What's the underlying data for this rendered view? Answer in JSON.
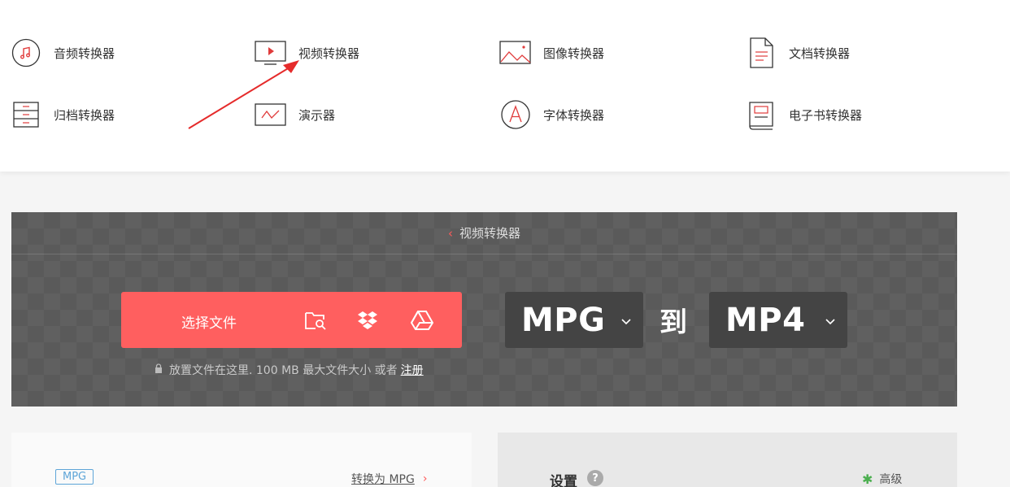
{
  "menu": {
    "items": [
      {
        "label": "音频转换器",
        "icon": "music-note-icon"
      },
      {
        "label": "视频转换器",
        "icon": "video-play-icon"
      },
      {
        "label": "图像转换器",
        "icon": "image-icon"
      },
      {
        "label": "文档转换器",
        "icon": "document-icon"
      },
      {
        "label": "归档转换器",
        "icon": "archive-icon"
      },
      {
        "label": "演示器",
        "icon": "presentation-icon"
      },
      {
        "label": "字体转换器",
        "icon": "font-icon"
      },
      {
        "label": "电子书转换器",
        "icon": "ebook-icon"
      }
    ]
  },
  "colors": {
    "accent": "#ff5f5f",
    "panel": "#5a5a5a",
    "select_bg": "#444444",
    "link_blue": "#5ea5d8",
    "gear_green": "#4caf50"
  },
  "converter": {
    "breadcrumb": "视频转换器",
    "choose_file": "选择文件",
    "drop_text": "放置文件在这里. 100 MB 最大文件大小 或者",
    "register": "注册",
    "from_format": "MPG",
    "to_word": "到",
    "to_format": "MP4"
  },
  "lower": {
    "badge": "MPG",
    "convert_to": "转换为 MPG",
    "settings": "设置",
    "help": "?",
    "advanced": "高级"
  }
}
